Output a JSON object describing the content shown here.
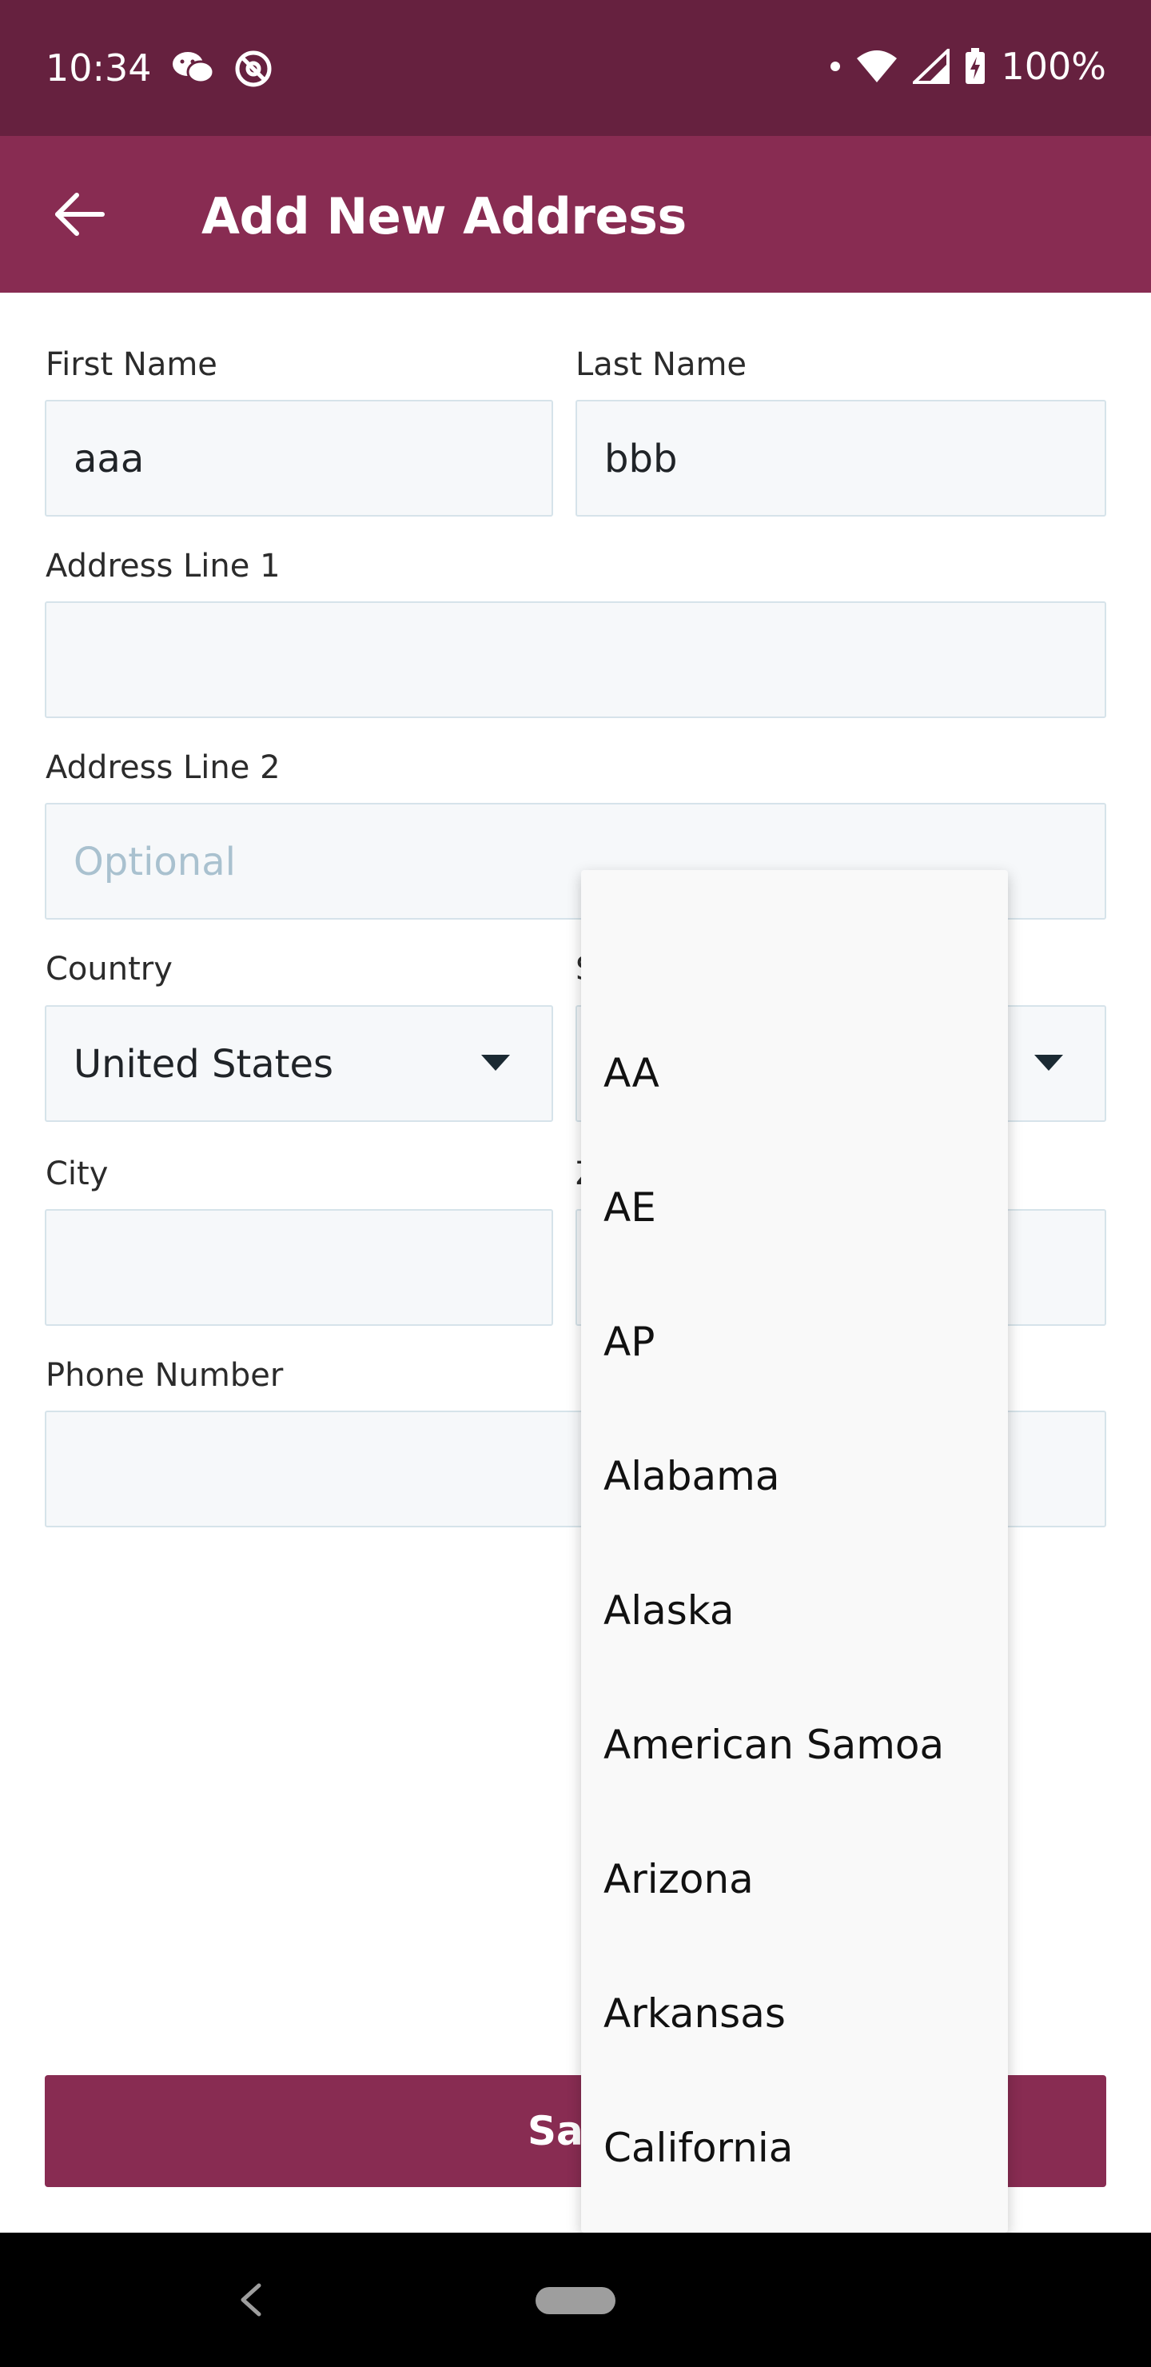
{
  "status_bar": {
    "time": "10:34",
    "battery": "100%",
    "icons": [
      "wechat-icon",
      "blocked-at-icon",
      "notification-dot-icon",
      "wifi-icon",
      "cell-signal-icon",
      "battery-charging-icon"
    ]
  },
  "app_bar": {
    "title": "Add New Address",
    "back_icon": "arrow-left-icon"
  },
  "form": {
    "first_name": {
      "label": "First Name",
      "value": "aaa"
    },
    "last_name": {
      "label": "Last Name",
      "value": "bbb"
    },
    "address_line_1": {
      "label": "Address Line 1",
      "value": ""
    },
    "address_line_2": {
      "label": "Address Line 2",
      "placeholder": "Optional"
    },
    "country": {
      "label": "Country",
      "value": "United States"
    },
    "state": {
      "label_partial": "S",
      "value": ""
    },
    "city": {
      "label": "City",
      "value": ""
    },
    "zip": {
      "label_partial": "Z",
      "value": ""
    },
    "phone": {
      "label": "Phone Number",
      "value": ""
    },
    "save_label_partial": "Sa"
  },
  "dropdown": {
    "items": [
      "",
      "AA",
      "AE",
      "AP",
      "Alabama",
      "Alaska",
      "American Samoa",
      "Arizona",
      "Arkansas",
      "California"
    ]
  },
  "colors": {
    "status_bar": "#66213f",
    "app_bar": "#882c52",
    "accent": "#882c52",
    "field_bg": "#f6f8fa",
    "field_border": "#d6e3ea"
  }
}
